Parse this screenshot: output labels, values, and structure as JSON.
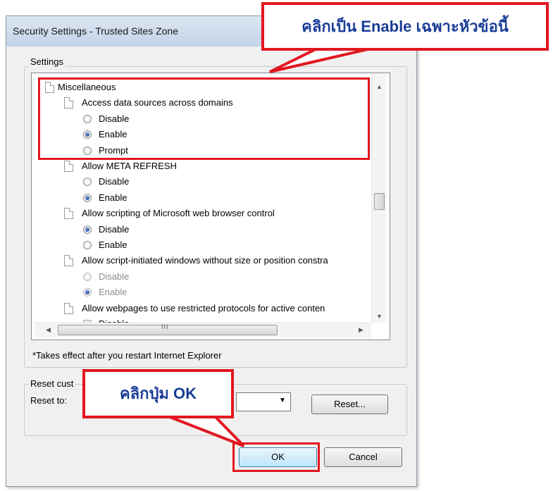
{
  "window": {
    "title": "Security Settings - Trusted Sites Zone"
  },
  "settings_group": {
    "label": "Settings",
    "tree": [
      {
        "kind": "heading",
        "label": "Miscellaneous"
      },
      {
        "kind": "setting",
        "label": "Access data sources across domains"
      },
      {
        "kind": "option",
        "label": "Disable",
        "checked": false,
        "disabled": false
      },
      {
        "kind": "option",
        "label": "Enable",
        "checked": true,
        "disabled": false
      },
      {
        "kind": "option",
        "label": "Prompt",
        "checked": false,
        "disabled": false
      },
      {
        "kind": "setting",
        "label": "Allow META REFRESH"
      },
      {
        "kind": "option",
        "label": "Disable",
        "checked": false,
        "disabled": false
      },
      {
        "kind": "option",
        "label": "Enable",
        "checked": true,
        "disabled": false
      },
      {
        "kind": "setting",
        "label": "Allow scripting of Microsoft web browser control"
      },
      {
        "kind": "option",
        "label": "Disable",
        "checked": true,
        "disabled": false
      },
      {
        "kind": "option",
        "label": "Enable",
        "checked": false,
        "disabled": false
      },
      {
        "kind": "setting",
        "label": "Allow script-initiated windows without size or position constra"
      },
      {
        "kind": "option",
        "label": "Disable",
        "checked": false,
        "disabled": true
      },
      {
        "kind": "option",
        "label": "Enable",
        "checked": true,
        "disabled": true
      },
      {
        "kind": "setting",
        "label": "Allow webpages to use restricted protocols for active conten"
      },
      {
        "kind": "option",
        "label": "Disable",
        "checked": false,
        "disabled": false
      }
    ],
    "hscroll_grip": "III",
    "note": "*Takes effect after you restart Internet Explorer"
  },
  "reset_group": {
    "label": "Reset cust",
    "reset_to_label": "Reset to:",
    "reset_button": "Reset..."
  },
  "buttons": {
    "ok": "OK",
    "cancel": "Cancel"
  },
  "annotations": {
    "top_callout": "คลิกเป็น Enable เฉพาะหัวข้อนี้",
    "bottom_callout": "คลิกปุ่ม OK"
  },
  "colors": {
    "annotation_red": "#e2171f",
    "annotation_text": "#1a3d96",
    "dialog_bg": "#f0f0f0"
  }
}
